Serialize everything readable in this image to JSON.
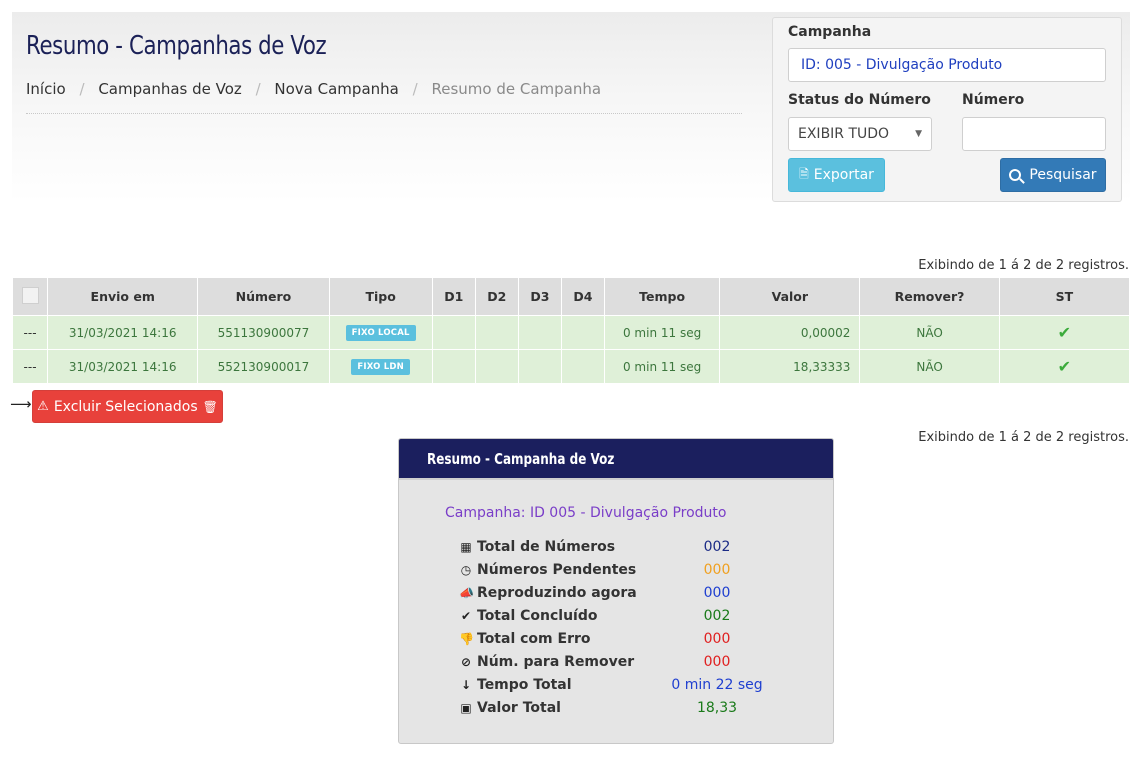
{
  "header": {
    "title": "Resumo - Campanhas de Voz",
    "breadcrumb": [
      "Início",
      "Campanhas de Voz",
      "Nova Campanha",
      "Resumo de Campanha"
    ]
  },
  "filter": {
    "campaign_label": "Campanha",
    "campaign_value": "ID: 005 - Divulgação Produto",
    "status_label": "Status do Número",
    "status_selected": "EXIBIR TUDO",
    "number_label": "Número",
    "number_value": "",
    "export_label": "Exportar",
    "search_label": "Pesquisar"
  },
  "records_info": "Exibindo de 1 á 2 de 2 registros.",
  "table": {
    "columns": [
      "",
      "Envio em",
      "Número",
      "Tipo",
      "D1",
      "D2",
      "D3",
      "D4",
      "Tempo",
      "Valor",
      "Remover?",
      "ST"
    ],
    "rows": [
      {
        "sel": "---",
        "envio": "31/03/2021 14:16",
        "numero": "551130900077",
        "tipo": "FIXO LOCAL",
        "d1": "",
        "d2": "",
        "d3": "",
        "d4": "",
        "tempo": "0 min 11 seg",
        "valor": "0,00002",
        "remover": "NÃO",
        "st": "ok"
      },
      {
        "sel": "---",
        "envio": "31/03/2021 14:16",
        "numero": "552130900017",
        "tipo": "FIXO LDN",
        "d1": "",
        "d2": "",
        "d3": "",
        "d4": "",
        "tempo": "0 min 11 seg",
        "valor": "18,33333",
        "remover": "NÃO",
        "st": "ok"
      }
    ]
  },
  "delete_button": "Excluir Selecionados",
  "summary": {
    "title": "Resumo - Campanha de Voz",
    "campaign": "Campanha: ID 005 - Divulgação Produto",
    "items": [
      {
        "icon": "table-icon",
        "label": "Total de Números",
        "value": "002",
        "color": "#1b2b86"
      },
      {
        "icon": "clock-icon",
        "label": "Números Pendentes",
        "value": "000",
        "color": "#f0a020"
      },
      {
        "icon": "megaphone-icon",
        "label": "Reproduzindo agora",
        "value": "000",
        "color": "#1f3fd0"
      },
      {
        "icon": "check-icon",
        "label": "Total Concluído",
        "value": "002",
        "color": "#1a7a1a"
      },
      {
        "icon": "thumbs-down-icon",
        "label": "Total com Erro",
        "value": "000",
        "color": "#e02020"
      },
      {
        "icon": "ban-icon",
        "label": "Núm. para Remover",
        "value": "000",
        "color": "#e02020"
      },
      {
        "icon": "sort-numeric-icon",
        "label": "Tempo Total",
        "value": "0 min 22 seg",
        "color": "#1f3fd0"
      },
      {
        "icon": "money-icon",
        "label": "Valor Total",
        "value": "18,33",
        "color": "#1a7a1a"
      }
    ]
  },
  "colors": {
    "title": "#1b2157",
    "row_success": "#dff0d8",
    "header_panel": "#1b1f5e",
    "info": "#5bc0de",
    "primary": "#337ab7",
    "danger": "#e8413b"
  }
}
